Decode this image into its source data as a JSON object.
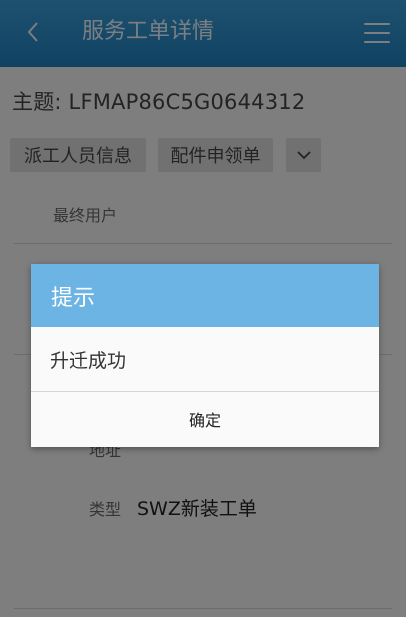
{
  "header": {
    "title": "服务工单详情",
    "back_icon": "chevron-left-icon",
    "menu_icon": "hamburger-menu-icon"
  },
  "subject": {
    "text": "主题: LFMAP86C5G0644312"
  },
  "tabs": [
    {
      "label": "派工人员信息"
    },
    {
      "label": "配件申领单"
    }
  ],
  "fields": {
    "end_user_label": "最终用户",
    "address_label": "地址",
    "type_label": "类型",
    "type_value": "SWZ新装工单"
  },
  "dialog": {
    "title": "提示",
    "message": "升迁成功",
    "ok_label": "确定"
  },
  "colors": {
    "header": "#2a8cc9",
    "dialog_header": "#6cb4e4"
  }
}
